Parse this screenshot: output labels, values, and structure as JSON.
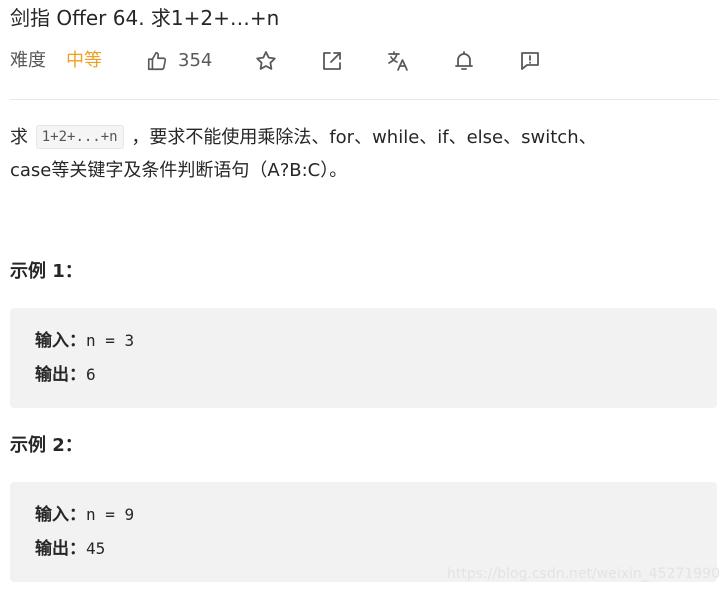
{
  "problem": {
    "title": "剑指 Offer 64. 求1+2+…+n",
    "difficulty_label": "难度",
    "difficulty_value": "中等",
    "likes": "354"
  },
  "toolbar": {
    "icons": [
      "thumbs-up-icon",
      "star-icon",
      "share-icon",
      "translate-icon",
      "bell-icon",
      "feedback-icon"
    ]
  },
  "description": {
    "prefix": "求 ",
    "code": "1+2+...+n",
    "line1_rest": " ，要求不能使用乘除法、for、while、if、else、switch、",
    "line2": "case等关键字及条件判断语句（A?B:C）。"
  },
  "examples": [
    {
      "title": "示例 1：",
      "input_label": "输入：",
      "input_value": "n = 3",
      "output_label": "输出：",
      "output_value": "6"
    },
    {
      "title": "示例 2：",
      "input_label": "输入：",
      "input_value": "n = 9",
      "output_label": "输出：",
      "output_value": "45"
    }
  ],
  "watermark": "https://blog.csdn.net/weixin_45271990",
  "colors": {
    "difficulty_medium": "#f0a020",
    "text": "#262626",
    "example_bg": "#f2f2f2"
  }
}
